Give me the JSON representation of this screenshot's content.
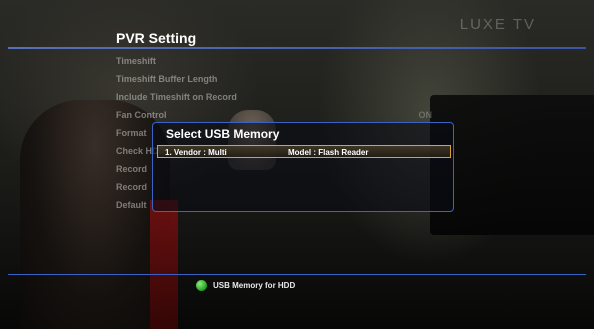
{
  "brand": "LUXE TV",
  "page_title": "PVR Setting",
  "menu": [
    {
      "label": "Timeshift",
      "value": ""
    },
    {
      "label": "Timeshift Buffer Length",
      "value": ""
    },
    {
      "label": "Include Timeshift on Record",
      "value": ""
    },
    {
      "label": "Fan Control",
      "value": "ON"
    },
    {
      "label": "Format",
      "value": ""
    },
    {
      "label": "Check HDD",
      "value": ""
    },
    {
      "label": "Record",
      "value": ""
    },
    {
      "label": "Record",
      "value": ""
    },
    {
      "label": "Default",
      "value": ""
    }
  ],
  "dialog": {
    "title": "Select USB Memory",
    "items": [
      {
        "vendor": "1. Vendor : Multi",
        "model": "Model : Flash Reader"
      }
    ]
  },
  "footer": {
    "button_color": "#1f9d1f",
    "label": "USB Memory for HDD"
  }
}
